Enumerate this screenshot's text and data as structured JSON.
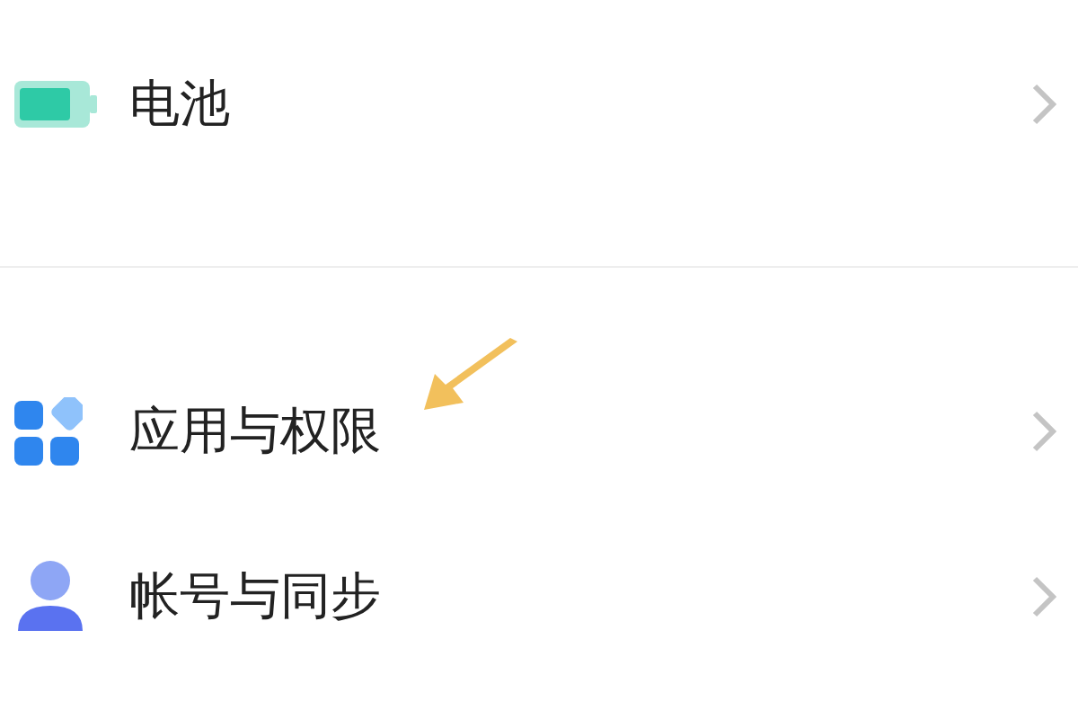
{
  "groups": [
    {
      "items": [
        {
          "kind": "battery",
          "label": "电池"
        }
      ]
    },
    {
      "items": [
        {
          "kind": "apps",
          "label": "应用与权限"
        },
        {
          "kind": "account",
          "label": "帐号与同步"
        }
      ]
    }
  ]
}
